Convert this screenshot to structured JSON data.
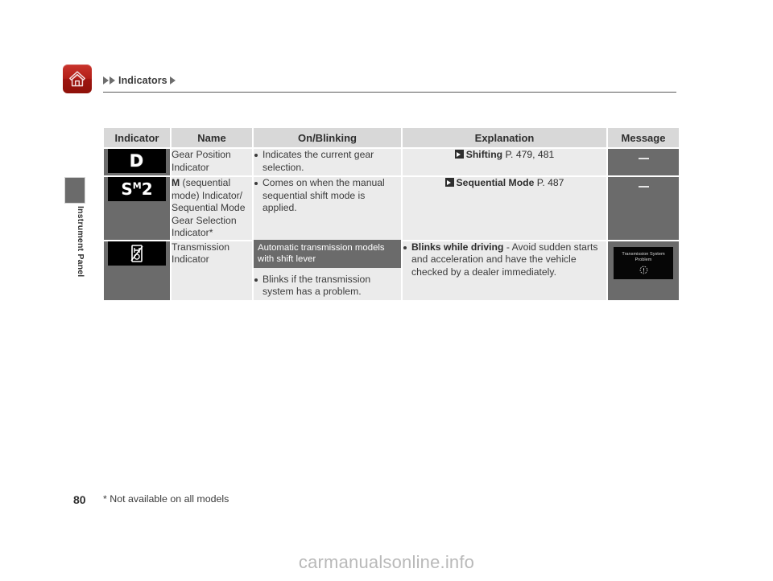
{
  "header": {
    "home_icon": "home-icon",
    "breadcrumb_arrow": "triangle-right-icon",
    "breadcrumb_label": "Indicators"
  },
  "sidebar": {
    "chapter_label": "Instrument Panel"
  },
  "table": {
    "columns": [
      "Indicator",
      "Name",
      "On/Blinking",
      "Explanation",
      "Message"
    ],
    "rows": [
      {
        "indicator_icon": "gear-position-D-indicator-icon",
        "indicator_glyph": "D",
        "name": "Gear Position Indicator",
        "onblinking": [
          "Indicates the current gear selection."
        ],
        "explanation_ref_icon": "reference-arrow-icon",
        "explanation_ref_title": "Shifting",
        "explanation_ref_page": "P. 479, 481",
        "message": "—"
      },
      {
        "indicator_icon": "sequential-mode-S-M-2-indicator-icon",
        "indicator_glyph_s": "S",
        "indicator_glyph_m": "M",
        "indicator_glyph_2": "2",
        "name_bold": "M",
        "name_rest": " (sequential mode) Indicator/ Sequential Mode Gear Selection Indicator*",
        "onblinking": [
          "Comes on when the manual sequential shift mode is applied."
        ],
        "explanation_ref_icon": "reference-arrow-icon",
        "explanation_ref_title": "Sequential Mode",
        "explanation_ref_page": "P. 487",
        "message": "—"
      },
      {
        "indicator_icon": "transmission-indicator-icon",
        "name": "Transmission Indicator",
        "band": "Automatic transmission models with shift lever",
        "onblinking": [
          "Blinks if the transmission system has a problem."
        ],
        "explanation_bold": "Blinks while driving",
        "explanation_rest": " - Avoid sudden starts and acceleration and have the vehicle checked by a dealer immediately.",
        "message_screen_line1": "Transmission System",
        "message_screen_line2": "Problem",
        "message_screen_icon": "transmission-warning-icon"
      }
    ]
  },
  "footer": {
    "page_number": "80",
    "footnote": "* Not available on all models",
    "watermark": "carmanualsonline.info"
  },
  "colors": {
    "accent_red": "#b42019",
    "header_gray": "#d8d8d8",
    "cell_gray": "#ebebeb",
    "dark_gray": "#6b6b6b",
    "screen_black": "#000000"
  }
}
